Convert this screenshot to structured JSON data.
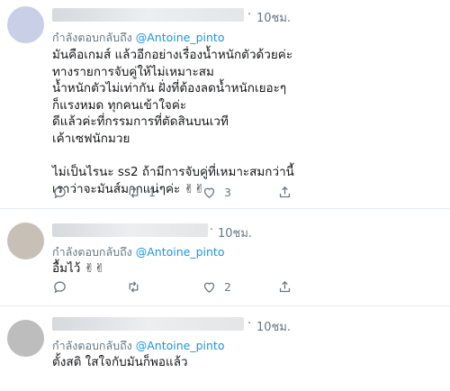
{
  "tweets": [
    {
      "dot": "·",
      "time": "10ชม.",
      "reply_prefix": "กำลังตอบกลับถึง",
      "mention": "@Antoine_pinto",
      "lines": [
        "มันคือเกมส์ แล้วอีกอย่างเรื่องน้ำหนักตัวด้วยค่ะ",
        "ทางรายการจับคู่ให้ไม่เหมาะสม",
        "น้ำหนักตัวไม่เท่ากัน ฝั่งที่ต้องลดน้ำหนักเยอะๆ",
        "ก็แรงหมด ทุกคนเข้าใจค่ะ",
        "ดีแล้วค่ะที่กรรมการที่ตัดสินบนเวที",
        "เค้าเซฟนักมวย",
        "",
        "ไม่เป็นไรนะ ss2 ถ้ามีการจับคู่ที่เหมาะสมกว่านี้",
        "เราว่าจะมันส์มากแน่ๆค่ะ ✌✌"
      ],
      "retweets": "1",
      "likes": "3",
      "icons": [
        "comment-icon",
        "retweet-icon",
        "heart-icon",
        "share-icon"
      ]
    },
    {
      "dot": "·",
      "time": "10ชม.",
      "reply_prefix": "กำลังตอบกลับถึง",
      "mention": "@Antoine_pinto",
      "lines": [
        "อื้มไว้ ✌✌"
      ],
      "retweets": "",
      "likes": "2",
      "icons": [
        "comment-icon",
        "retweet-icon",
        "heart-icon",
        "share-icon"
      ]
    },
    {
      "dot": "·",
      "time": "10ชม.",
      "reply_prefix": "กำลังตอบกลับถึง",
      "mention": "@Antoine_pinto",
      "lines": [
        "ตั้งสติ ใสใจกับมันก็พอแล้ว"
      ],
      "retweets": "",
      "likes": "",
      "icons": [
        "comment-icon",
        "retweet-icon",
        "heart-icon",
        "share-icon"
      ]
    }
  ],
  "colors": {
    "accent": "#1b95e0",
    "muted": "#657786",
    "divider": "#e6ecf0"
  }
}
